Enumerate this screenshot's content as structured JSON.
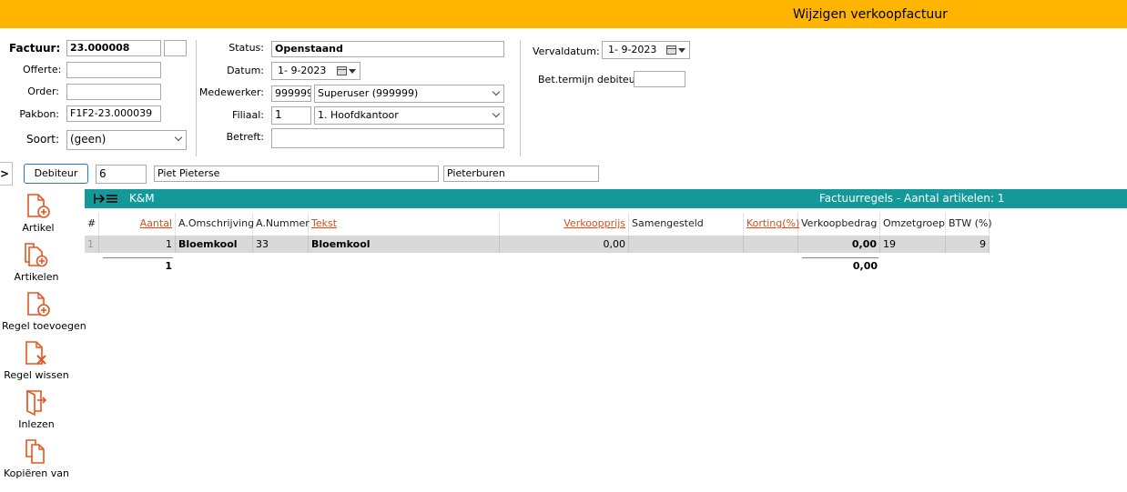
{
  "window": {
    "title": "Wijzigen verkoopfactuur"
  },
  "header": {
    "factuur_label": "Factuur:",
    "factuur_value": "23.000008",
    "offerte_label": "Offerte:",
    "offerte_value": "",
    "order_label": "Order:",
    "order_value": "",
    "pakbon_label": "Pakbon:",
    "pakbon_value": "F1F2-23.000039",
    "soort_label": "Soort:",
    "soort_value": "(geen)",
    "status_label": "Status:",
    "status_value": "Openstaand",
    "datum_label": "Datum:",
    "datum_value": "1-  9-2023",
    "medewerker_label": "Medewerker:",
    "medewerker_code": "999999",
    "medewerker_name": "Superuser (999999)",
    "filiaal_label": "Filiaal:",
    "filiaal_code": "1",
    "filiaal_name": "1. Hoofdkantoor",
    "betreft_label": "Betreft:",
    "betreft_value": "",
    "vervaldatum_label": "Vervaldatum:",
    "vervaldatum_value": "1-  9-2023",
    "bettermijn_label": "Bet.termijn debiteur",
    "bettermijn_value": ""
  },
  "debtor": {
    "button_label": "Debiteur",
    "expand_label": ">",
    "number": "6",
    "name": "Piet Pieterse",
    "city": "Pieterburen"
  },
  "toolbar": {
    "left_label": "K&M",
    "right_label": "Factuurregels - Aantal artikelen: 1"
  },
  "sidebar": {
    "items": [
      {
        "label": "Artikel",
        "icon": "doc-add-icon"
      },
      {
        "label": "Artikelen",
        "icon": "docs-add-icon"
      },
      {
        "label": "Regel toevoegen",
        "icon": "doc-add-icon"
      },
      {
        "label": "Regel wissen",
        "icon": "doc-delete-icon"
      },
      {
        "label": "Inlezen",
        "icon": "import-icon"
      },
      {
        "label": "Kopiëren van",
        "icon": "copy-icon"
      }
    ]
  },
  "table": {
    "headers": [
      "#",
      "Aantal",
      "A.Omschrijving",
      "A.Nummer",
      "Tekst",
      "Verkoopprijs",
      "Samengesteld",
      "Korting(%)",
      "Verkoopbedrag",
      "Omzetgroep",
      "BTW (%)"
    ],
    "rows": [
      {
        "index": "1",
        "aantal": "1",
        "omschrijving": "Bloemkool",
        "nummer": "33",
        "tekst": "Bloemkool",
        "verkoopprijs": "0,00",
        "samengesteld": "",
        "korting": "",
        "verkoopbedrag": "0,00",
        "omzetgroep": "19",
        "btw": "9"
      }
    ],
    "totals": {
      "aantal": "1",
      "verkoopbedrag": "0,00"
    }
  },
  "colors": {
    "accent": "#ffb400",
    "toolbar": "#139999",
    "icon": "#e8541e",
    "link": "#d4501a"
  }
}
